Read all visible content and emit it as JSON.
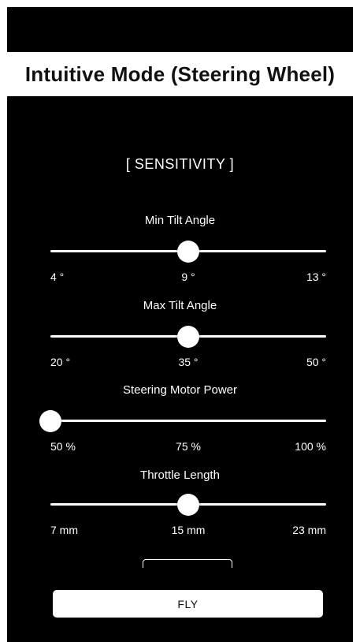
{
  "header": {
    "title": "Intuitive Mode (Steering Wheel)"
  },
  "section_title": "[ SENSITIVITY ]",
  "sliders": [
    {
      "label": "Min Tilt Angle",
      "min_label": "4 °",
      "mid_label": "9 °",
      "max_label": "13 °",
      "value_fraction": 0.5
    },
    {
      "label": "Max Tilt Angle",
      "min_label": "20 °",
      "mid_label": "35 °",
      "max_label": "50 °",
      "value_fraction": 0.5
    },
    {
      "label": "Steering Motor Power",
      "min_label": "50 %",
      "mid_label": "75 %",
      "max_label": "100 %",
      "value_fraction": 0.0
    },
    {
      "label": "Throttle Length",
      "min_label": "7 mm",
      "mid_label": "15 mm",
      "max_label": "23 mm",
      "value_fraction": 0.5
    }
  ],
  "fly_button": {
    "label": "FLY"
  }
}
